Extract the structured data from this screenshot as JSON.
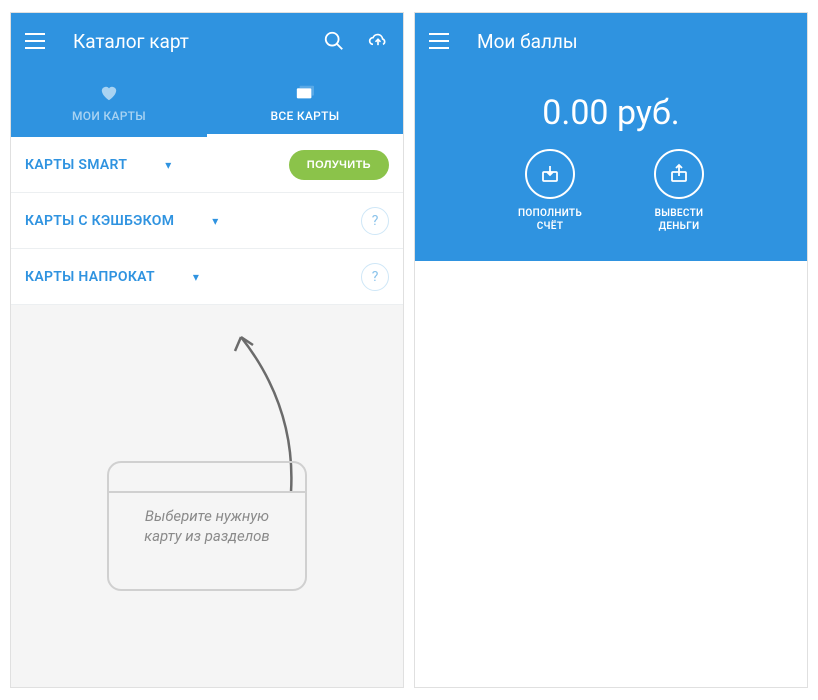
{
  "left": {
    "header": {
      "title": "Каталог карт"
    },
    "tabs": {
      "my_cards": "МОИ КАРТЫ",
      "all_cards": "ВСЕ КАРТЫ"
    },
    "rows": {
      "smart": {
        "title": "КАРТЫ SMART",
        "action": "ПОЛУЧИТЬ"
      },
      "cashback": {
        "title": "КАРТЫ С КЭШБЭКОМ"
      },
      "rent": {
        "title": "КАРТЫ НАПРОКАТ"
      }
    },
    "empty": {
      "hint": "Выберите нужную карту из разделов"
    }
  },
  "right": {
    "header": {
      "title": "Мои баллы"
    },
    "balance": "0.00 руб.",
    "actions": {
      "deposit": "ПОПОЛНИТЬ СЧЁТ",
      "withdraw": "ВЫВЕСТИ ДЕНЬГИ"
    }
  },
  "colors": {
    "primary": "#2f93e0",
    "accent": "#8bc34a"
  }
}
